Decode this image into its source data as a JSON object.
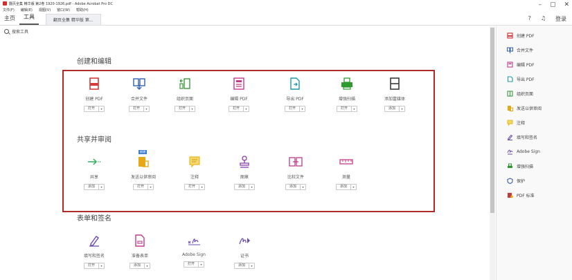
{
  "window": {
    "title": "翻页全集 精华版 第2卷 1920-1926.pdf - Adobe Acrobat Pro DC",
    "menus": [
      "文件(F)",
      "编辑(E)",
      "视图(V)",
      "窗口(W)",
      "帮助(H)"
    ],
    "controls": {
      "minimize": "–",
      "maximize": "▢",
      "close": "✕"
    }
  },
  "tabs": {
    "home": "主页",
    "tools": "工具",
    "document": "翻页全集 精华版 第..."
  },
  "top_right": {
    "help_icon": "?",
    "bell_icon": "♫",
    "signin": "登录"
  },
  "search": {
    "placeholder": "搜索工具"
  },
  "sections": [
    {
      "title": "创建和编辑"
    },
    {
      "title": "共享并审阅"
    },
    {
      "title": "表单和签名"
    }
  ],
  "tools_create": [
    {
      "name": "创建 PDF",
      "button": "打开",
      "icon": "create-pdf",
      "color": "#d63b3b"
    },
    {
      "name": "合并文件",
      "button": "打开",
      "icon": "combine-files",
      "color": "#2f5fb3"
    },
    {
      "name": "组织页面",
      "button": "打开",
      "icon": "organize-pages",
      "color": "#3b9a3b"
    },
    {
      "name": "编辑 PDF",
      "button": "打开",
      "icon": "edit-pdf",
      "color": "#c43a8a"
    },
    {
      "name": "导出 PDF",
      "button": "打开",
      "icon": "export-pdf",
      "color": "#1f9aa8"
    },
    {
      "name": "增强扫描",
      "button": "打开",
      "icon": "enhance-scans",
      "color": "#2f9a2f"
    },
    {
      "name": "添加富媒体",
      "button": "添加",
      "icon": "rich-media",
      "color": "#3a3a3a"
    }
  ],
  "tools_share": [
    {
      "name": "共享",
      "button": "添加",
      "icon": "share",
      "color": "#2fae5a"
    },
    {
      "name": "发送以供审阅",
      "button": "打开",
      "icon": "send-review",
      "color": "#e6a817",
      "badge": "新增"
    },
    {
      "name": "注释",
      "button": "打开",
      "icon": "comment",
      "color": "#e6b820"
    },
    {
      "name": "图章",
      "button": "添加",
      "icon": "stamp",
      "color": "#8a3ab0"
    },
    {
      "name": "比较文件",
      "button": "添加",
      "icon": "compare-files",
      "color": "#c43a8a"
    },
    {
      "name": "测量",
      "button": "添加",
      "icon": "measure",
      "color": "#c43a8a"
    }
  ],
  "tools_forms": [
    {
      "name": "填写和签名",
      "button": "打开",
      "icon": "fill-sign",
      "color": "#6a4ab0"
    },
    {
      "name": "准备表单",
      "button": "添加",
      "icon": "prepare-form",
      "color": "#c43a8a"
    },
    {
      "name": "Adobe Sign",
      "button": "打开",
      "icon": "adobe-sign",
      "color": "#6a4ab0"
    },
    {
      "name": "证书",
      "button": "添加",
      "icon": "certificates",
      "color": "#6a4ab0"
    }
  ],
  "right_panel": [
    {
      "label": "创建 PDF",
      "color": "#d63b3b"
    },
    {
      "label": "合并文件",
      "color": "#2f5fb3"
    },
    {
      "label": "编辑 PDF",
      "color": "#c43a8a"
    },
    {
      "label": "导出 PDF",
      "color": "#1f9aa8"
    },
    {
      "label": "组织页面",
      "color": "#3b9a3b"
    },
    {
      "label": "发送以供审阅",
      "color": "#e6a817"
    },
    {
      "label": "注释",
      "color": "#e6b820"
    },
    {
      "label": "填写和签名",
      "color": "#6a4ab0"
    },
    {
      "label": "Adobe Sign",
      "color": "#6a4ab0"
    },
    {
      "label": "增强扫描",
      "color": "#2f9a2f"
    },
    {
      "label": "保护",
      "color": "#3a5ab0"
    },
    {
      "label": "PDF 标准",
      "color": "#c43a3a"
    }
  ],
  "dropdown_glyph": "▾"
}
